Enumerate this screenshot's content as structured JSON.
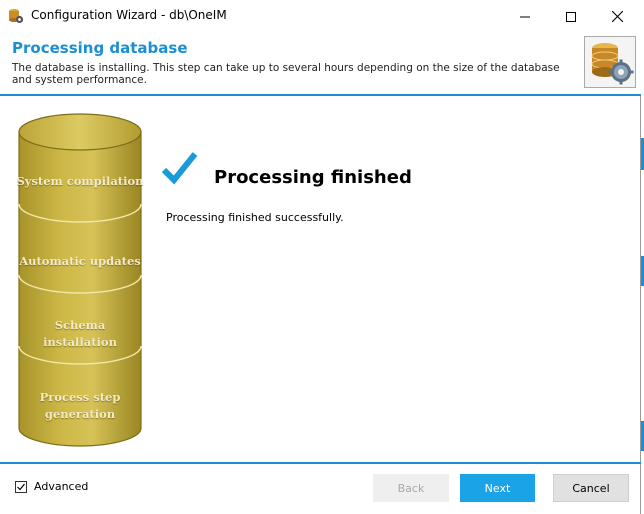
{
  "window": {
    "title": "Configuration Wizard - db\\OneIM",
    "minimize_icon": "minimize-icon",
    "maximize_icon": "maximize-icon",
    "close_icon": "close-icon"
  },
  "header": {
    "title": "Processing database",
    "subtitle": "The database is installing. This step can take up to several hours depending on the size of the database and system performance.",
    "logo_icon": "database-gear-icon"
  },
  "steps": [
    {
      "label": "System compilation"
    },
    {
      "label": "Automatic updates"
    },
    {
      "label": "Schema installation"
    },
    {
      "label": "Process step generation"
    }
  ],
  "result": {
    "icon": "checkmark-icon",
    "title": "Processing finished",
    "message": "Processing finished successfully."
  },
  "footer": {
    "advanced_label": "Advanced",
    "advanced_checked": true,
    "back_label": "Back",
    "back_enabled": false,
    "next_label": "Next",
    "cancel_label": "Cancel"
  },
  "colors": {
    "accent": "#1b8ed6",
    "header_title": "#1a8fd3",
    "next_button": "#1aa3e6",
    "cylinder": "#c9b53f"
  }
}
